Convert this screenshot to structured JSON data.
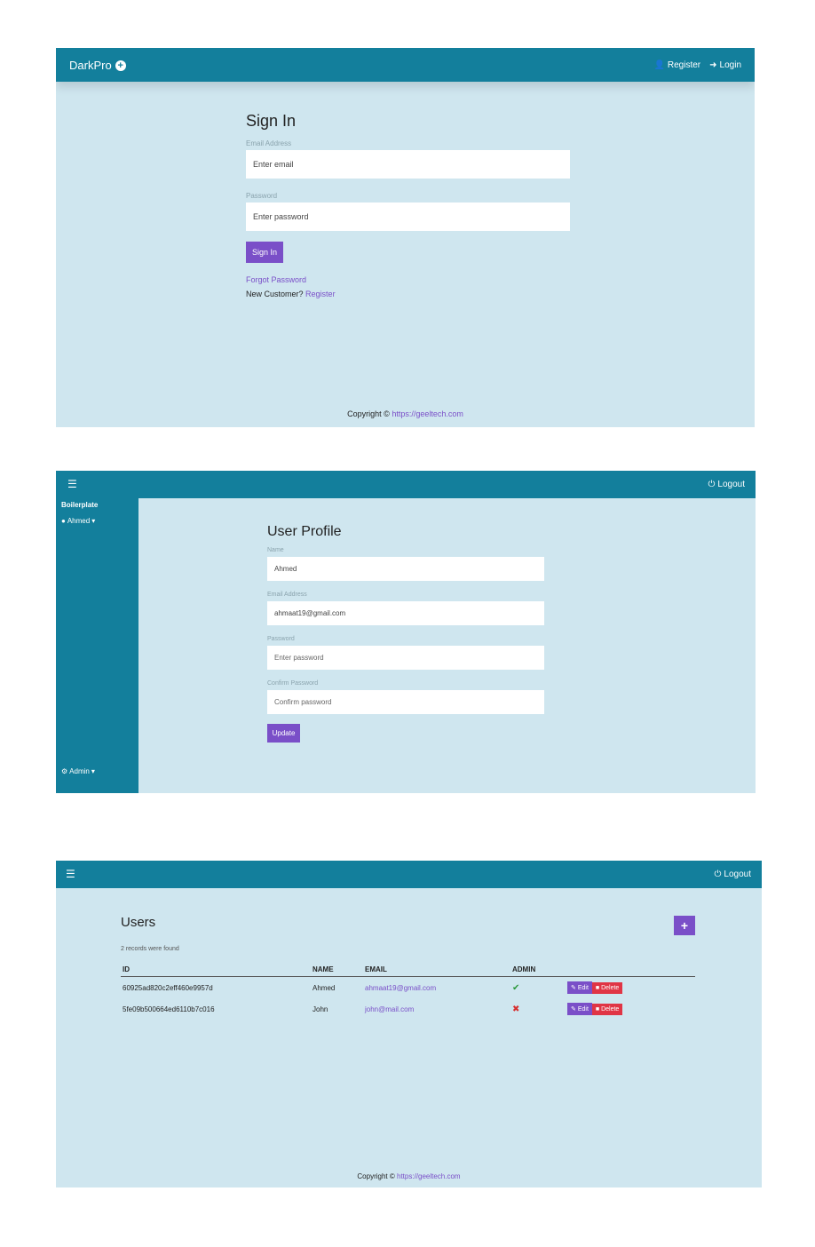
{
  "signin_screen": {
    "navbar": {
      "brand": "DarkPro",
      "register": "Register",
      "login": "Login"
    },
    "title": "Sign In",
    "email_label": "Email Address",
    "email_placeholder": "Enter email",
    "password_label": "Password",
    "password_placeholder": "Enter password",
    "submit_label": "Sign In",
    "forgot_password": "Forgot Password",
    "new_customer_text": "New Customer?",
    "register_link": "Register",
    "footer_text": "Copyright ©",
    "footer_link": "https://geeltech.com"
  },
  "profile_screen": {
    "logout": "Logout",
    "sidebar": {
      "title": "Boilerplate",
      "user_menu": "Ahmed",
      "admin_menu": "Admin"
    },
    "title": "User Profile",
    "name_label": "Name",
    "name_value": "Ahmed",
    "email_label": "Email Address",
    "email_value": "ahmaat19@gmail.com",
    "password_label": "Password",
    "password_placeholder": "Enter password",
    "confirm_label": "Confirm Password",
    "confirm_placeholder": "Confirm password",
    "update_label": "Update"
  },
  "users_screen": {
    "logout": "Logout",
    "title": "Users",
    "add_button": "+",
    "records_found": "2 records were found",
    "columns": [
      "ID",
      "NAME",
      "EMAIL",
      "ADMIN"
    ],
    "rows": [
      {
        "id": "60925ad820c2eff460e9957d",
        "name": "Ahmed",
        "email": "ahmaat19@gmail.com",
        "admin": true
      },
      {
        "id": "5fe09b500664ed6110b7c016",
        "name": "John",
        "email": "john@mail.com",
        "admin": false
      }
    ],
    "edit_label": "Edit",
    "delete_label": "Delete",
    "footer_text": "Copyright ©",
    "footer_link": "https://geeltech.com"
  },
  "colors": {
    "topbar": "#137f9c",
    "background": "#cfe6ef",
    "accent": "#7a4fc8",
    "danger": "#e03545",
    "success": "#2e9a3e"
  }
}
